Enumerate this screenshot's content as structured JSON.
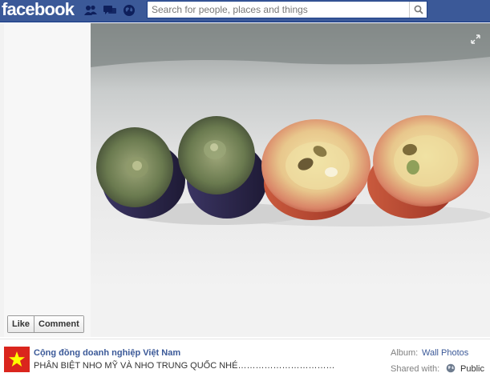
{
  "header": {
    "logo": "facebook",
    "search_placeholder": "Search for people, places and things"
  },
  "actions": {
    "like": "Like",
    "comment": "Comment"
  },
  "post": {
    "page_name": "Cộng đồng doanh nghiệp Việt Nam",
    "caption": "PHÂN BIỆT NHO MỸ VÀ NHO TRUNG QUỐC NHÉ……………………………",
    "album_label": "Album:",
    "album_value": "Wall Photos",
    "shared_label": "Shared with:",
    "shared_value": "Public"
  },
  "colors": {
    "brand": "#3b5998",
    "flag_red": "#da251d",
    "flag_star": "#ffff00"
  }
}
